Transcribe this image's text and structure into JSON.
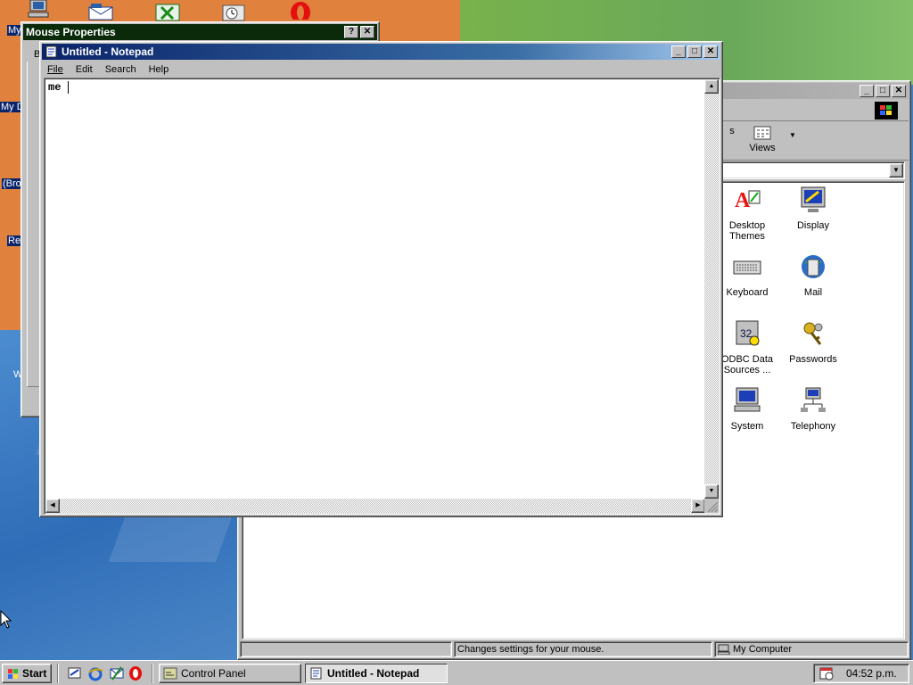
{
  "desktop": {
    "icon_labels": [
      "My",
      "My D",
      "(Bro",
      "Re",
      "W"
    ]
  },
  "mouse_props": {
    "title": "Mouse Properties",
    "help_btn": "?",
    "close_btn": "✕",
    "fragment": "B"
  },
  "notepad": {
    "title": "Untitled - Notepad",
    "menu": [
      "File",
      "Edit",
      "Search",
      "Help"
    ],
    "text": "me ",
    "min_btn": "_",
    "max_btn": "□",
    "close_btn": "✕"
  },
  "control_panel": {
    "views_label": "Views",
    "items": [
      {
        "label": "Desktop Themes",
        "icon": "desktop-themes-icon"
      },
      {
        "label": "Display",
        "icon": "display-icon"
      },
      {
        "label": "Keyboard",
        "icon": "keyboard-icon"
      },
      {
        "label": "Mail",
        "icon": "mail-icon"
      },
      {
        "label": "ODBC Data Sources ...",
        "icon": "odbc-icon"
      },
      {
        "label": "Passwords",
        "icon": "passwords-icon"
      },
      {
        "label": "System",
        "icon": "system-icon"
      },
      {
        "label": "Telephony",
        "icon": "telephony-icon"
      }
    ],
    "status_left": "Changes settings for your mouse.",
    "status_right": "My Computer"
  },
  "taskbar": {
    "start": "Start",
    "tasks": [
      "Control Panel",
      "Untitled - Notepad"
    ],
    "clock": "04:52 p.m."
  },
  "colors": {
    "title_active": "#0a246a",
    "desktop_orange": "#e0823e",
    "desktop_blue": "#3f7fc4"
  }
}
